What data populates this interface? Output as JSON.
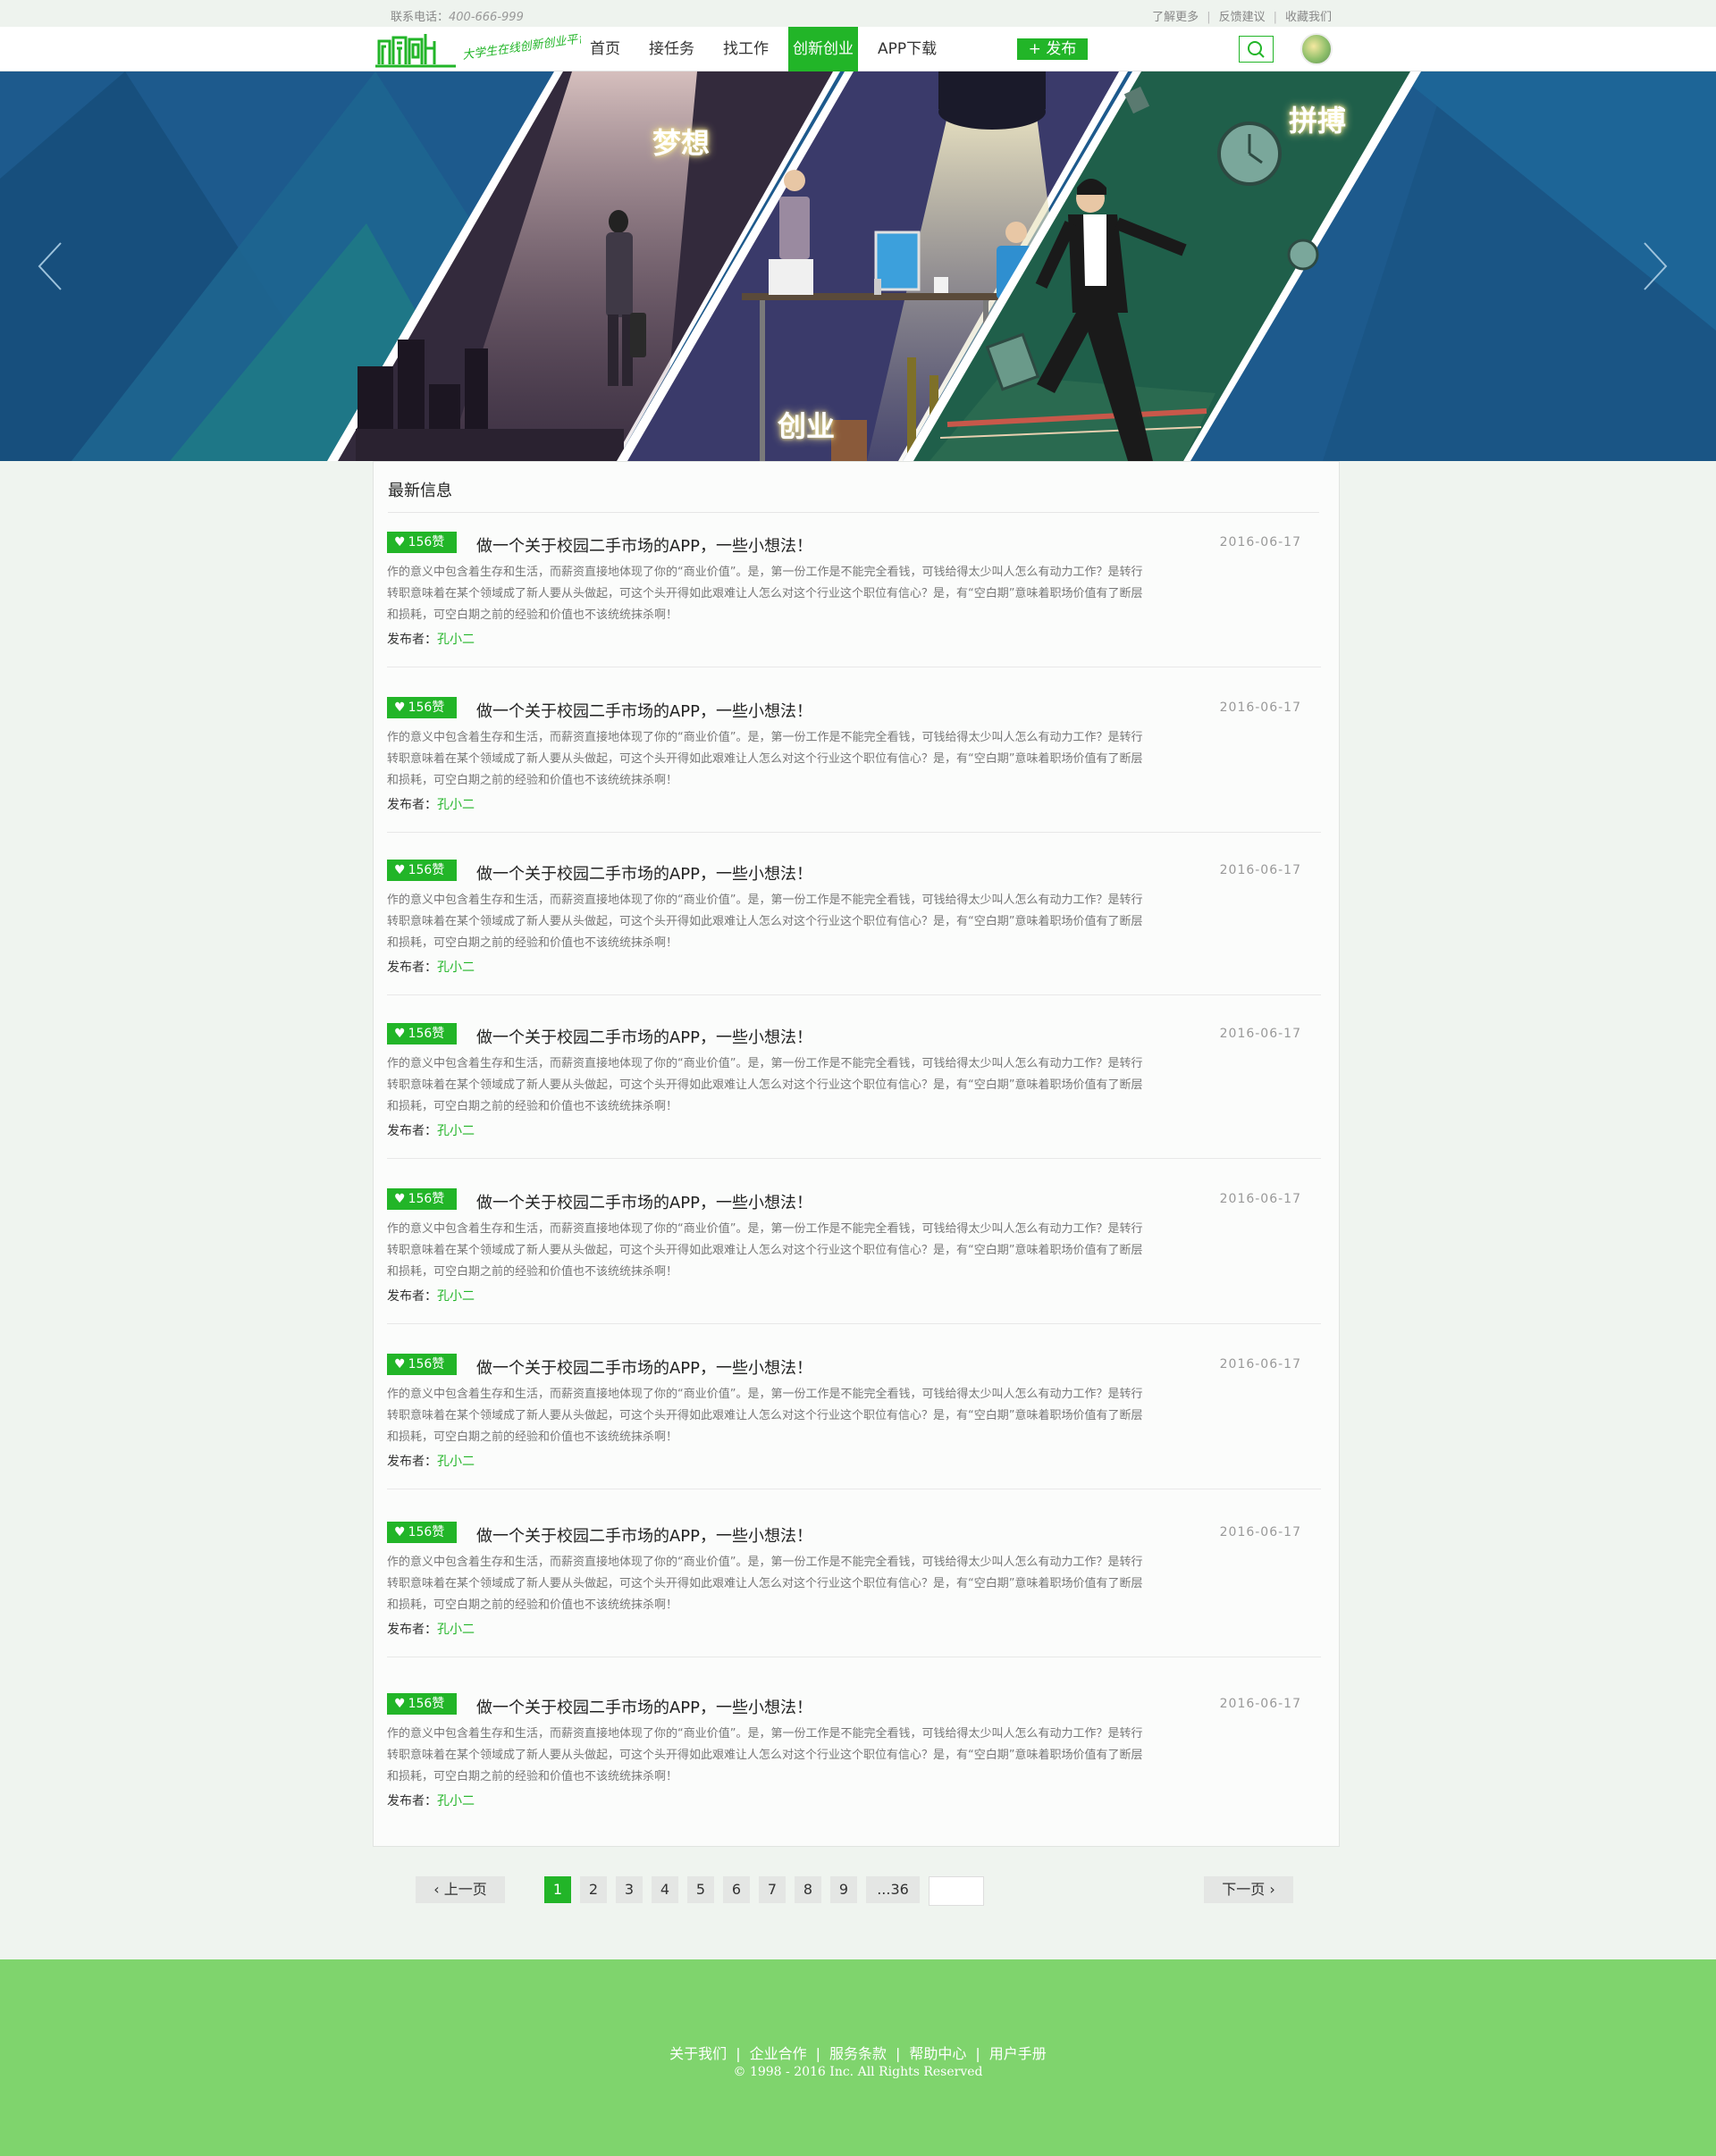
{
  "topbar": {
    "phone_label": "联系电话：",
    "phone_number": "400-666-999",
    "links": [
      "了解更多",
      "反馈建议",
      "收藏我们"
    ]
  },
  "header": {
    "logo_text": "创新创业",
    "logo_slogan": "大学生在线创新创业平台",
    "nav": [
      "首页",
      "接任务",
      "找工作",
      "创新创业",
      "APP下载"
    ],
    "active_nav": "创新创业",
    "publish_label": "+ 发布",
    "search_icon": "search-icon",
    "accent_color": "#22b528"
  },
  "banner": {
    "words": [
      "梦想",
      "创业",
      "拼搏"
    ],
    "prev_icon": "chevron-left-icon",
    "next_icon": "chevron-right-icon"
  },
  "main": {
    "section_title": "最新信息",
    "posts": [
      {
        "likes": "156赞",
        "title": "做一个关于校园二手市场的APP，一些小想法！",
        "date": "2016-06-17",
        "body": [
          "作的意义中包含着生存和生活，而薪资直接地体现了你的“商业价值”。是，第一份工作是不能完全看钱，可钱给得太少叫人怎么有动力工作？是转行",
          "转职意味着在某个领域成了新人要从头做起，可这个头开得如此艰难让人怎么对这个行业这个职位有信心？是，有“空白期”意味着职场价值有了断层",
          "和损耗，可空白期之前的经验和价值也不该统统抹杀啊！"
        ],
        "author_label": "发布者：",
        "author": "孔小二"
      },
      {
        "likes": "156赞",
        "title": "做一个关于校园二手市场的APP，一些小想法！",
        "date": "2016-06-17",
        "body": [
          "作的意义中包含着生存和生活，而薪资直接地体现了你的“商业价值”。是，第一份工作是不能完全看钱，可钱给得太少叫人怎么有动力工作？是转行",
          "转职意味着在某个领域成了新人要从头做起，可这个头开得如此艰难让人怎么对这个行业这个职位有信心？是，有“空白期”意味着职场价值有了断层",
          "和损耗，可空白期之前的经验和价值也不该统统抹杀啊！"
        ],
        "author_label": "发布者：",
        "author": "孔小二"
      },
      {
        "likes": "156赞",
        "title": "做一个关于校园二手市场的APP，一些小想法！",
        "date": "2016-06-17",
        "body": [
          "作的意义中包含着生存和生活，而薪资直接地体现了你的“商业价值”。是，第一份工作是不能完全看钱，可钱给得太少叫人怎么有动力工作？是转行",
          "转职意味着在某个领域成了新人要从头做起，可这个头开得如此艰难让人怎么对这个行业这个职位有信心？是，有“空白期”意味着职场价值有了断层",
          "和损耗，可空白期之前的经验和价值也不该统统抹杀啊！"
        ],
        "author_label": "发布者：",
        "author": "孔小二"
      },
      {
        "likes": "156赞",
        "title": "做一个关于校园二手市场的APP，一些小想法！",
        "date": "2016-06-17",
        "body": [
          "作的意义中包含着生存和生活，而薪资直接地体现了你的“商业价值”。是，第一份工作是不能完全看钱，可钱给得太少叫人怎么有动力工作？是转行",
          "转职意味着在某个领域成了新人要从头做起，可这个头开得如此艰难让人怎么对这个行业这个职位有信心？是，有“空白期”意味着职场价值有了断层",
          "和损耗，可空白期之前的经验和价值也不该统统抹杀啊！"
        ],
        "author_label": "发布者：",
        "author": "孔小二"
      },
      {
        "likes": "156赞",
        "title": "做一个关于校园二手市场的APP，一些小想法！",
        "date": "2016-06-17",
        "body": [
          "作的意义中包含着生存和生活，而薪资直接地体现了你的“商业价值”。是，第一份工作是不能完全看钱，可钱给得太少叫人怎么有动力工作？是转行",
          "转职意味着在某个领域成了新人要从头做起，可这个头开得如此艰难让人怎么对这个行业这个职位有信心？是，有“空白期”意味着职场价值有了断层",
          "和损耗，可空白期之前的经验和价值也不该统统抹杀啊！"
        ],
        "author_label": "发布者：",
        "author": "孔小二"
      },
      {
        "likes": "156赞",
        "title": "做一个关于校园二手市场的APP，一些小想法！",
        "date": "2016-06-17",
        "body": [
          "作的意义中包含着生存和生活，而薪资直接地体现了你的“商业价值”。是，第一份工作是不能完全看钱，可钱给得太少叫人怎么有动力工作？是转行",
          "转职意味着在某个领域成了新人要从头做起，可这个头开得如此艰难让人怎么对这个行业这个职位有信心？是，有“空白期”意味着职场价值有了断层",
          "和损耗，可空白期之前的经验和价值也不该统统抹杀啊！"
        ],
        "author_label": "发布者：",
        "author": "孔小二"
      },
      {
        "likes": "156赞",
        "title": "做一个关于校园二手市场的APP，一些小想法！",
        "date": "2016-06-17",
        "body": [
          "作的意义中包含着生存和生活，而薪资直接地体现了你的“商业价值”。是，第一份工作是不能完全看钱，可钱给得太少叫人怎么有动力工作？是转行",
          "转职意味着在某个领域成了新人要从头做起，可这个头开得如此艰难让人怎么对这个行业这个职位有信心？是，有“空白期”意味着职场价值有了断层",
          "和损耗，可空白期之前的经验和价值也不该统统抹杀啊！"
        ],
        "author_label": "发布者：",
        "author": "孔小二"
      },
      {
        "likes": "156赞",
        "title": "做一个关于校园二手市场的APP，一些小想法！",
        "date": "2016-06-17",
        "body": [
          "作的意义中包含着生存和生活，而薪资直接地体现了你的“商业价值”。是，第一份工作是不能完全看钱，可钱给得太少叫人怎么有动力工作？是转行",
          "转职意味着在某个领域成了新人要从头做起，可这个头开得如此艰难让人怎么对这个行业这个职位有信心？是，有“空白期”意味着职场价值有了断层",
          "和损耗，可空白期之前的经验和价值也不该统统抹杀啊！"
        ],
        "author_label": "发布者：",
        "author": "孔小二"
      }
    ]
  },
  "pagination": {
    "prev_label": "上一页",
    "next_label": "下一页",
    "pages": [
      "1",
      "2",
      "3",
      "4",
      "5",
      "6",
      "7",
      "8",
      "9",
      "...36"
    ],
    "current_page": "1",
    "jump_input_value": ""
  },
  "footer": {
    "links": [
      "关于我们",
      "企业合作",
      "服务条款",
      "帮助中心",
      "用户手册"
    ],
    "copyright": "© 1998 - 2016  Inc. All Rights Reserved",
    "background_color": "#7fd46d"
  }
}
